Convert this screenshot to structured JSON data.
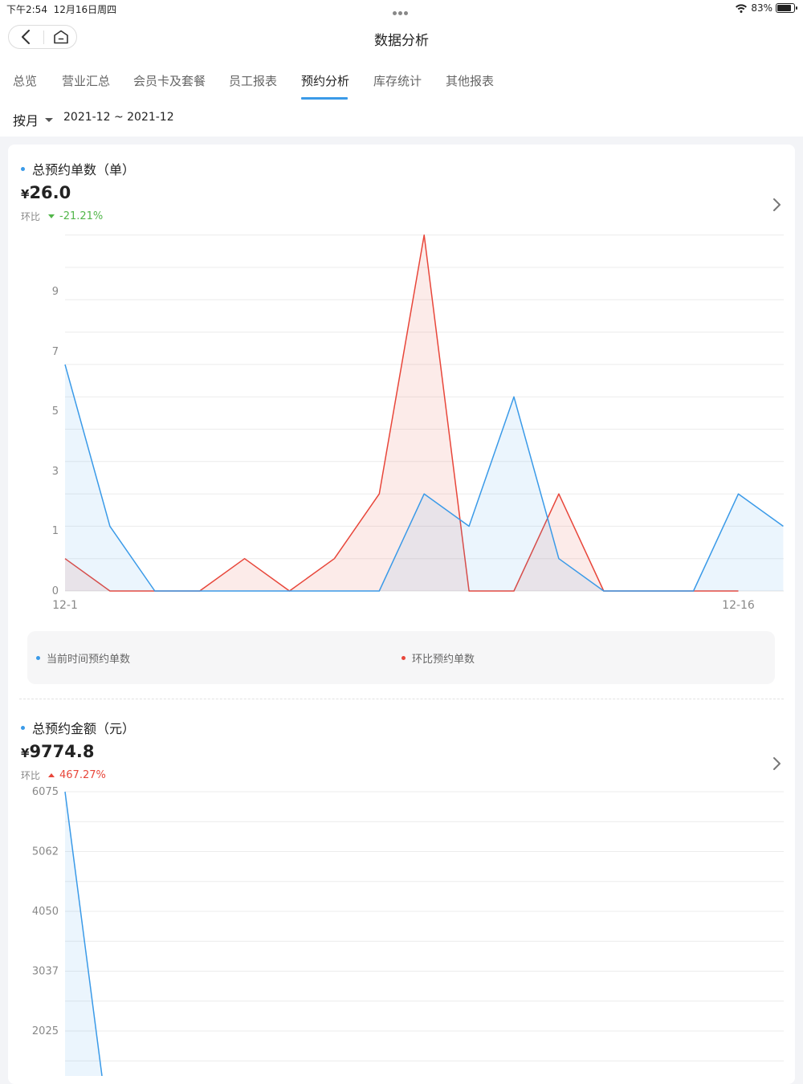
{
  "status": {
    "time": "下午2:54",
    "date": "12月16日周四",
    "battery_pct": "83%",
    "battery_level": 0.83
  },
  "nav": {
    "title": "数据分析"
  },
  "tabs": [
    {
      "label": "总览"
    },
    {
      "label": "营业汇总"
    },
    {
      "label": "会员卡及套餐"
    },
    {
      "label": "员工报表"
    },
    {
      "label": "预约分析"
    },
    {
      "label": "库存统计"
    },
    {
      "label": "其他报表"
    }
  ],
  "active_tab_index": 4,
  "filter": {
    "mode": "按月",
    "range": "2021-12 ~ 2021-12"
  },
  "colors": {
    "current": "#3a9ae8",
    "previous": "#e8463a",
    "up": "#e8463a",
    "down": "#52b64a"
  },
  "section1": {
    "title": "总预约单数（单）",
    "currency": "¥",
    "value": "26.0",
    "change_label": "环比",
    "change_dir": "down",
    "change_pct": "-21.21%"
  },
  "section2": {
    "title": "总预约金额（元）",
    "currency": "¥",
    "value": "9774.8",
    "change_label": "环比",
    "change_dir": "up",
    "change_pct": "467.27%"
  },
  "legend": {
    "current_label": "当前时间预约单数",
    "previous_label": "环比预约单数"
  },
  "chart_data": [
    {
      "type": "area",
      "x_labels": [
        "12-1",
        "12-16"
      ],
      "y_ticks": [
        0,
        1,
        3,
        5,
        7,
        9
      ],
      "ylim": [
        0,
        11
      ],
      "grid": true,
      "series": [
        {
          "name": "当前时间预约单数",
          "values": [
            7,
            2,
            0,
            0,
            0,
            0,
            0,
            0,
            3,
            2,
            6,
            1,
            0,
            0,
            0,
            3,
            2
          ]
        },
        {
          "name": "环比预约单数",
          "values": [
            1,
            0,
            0,
            0,
            1,
            0,
            1,
            3,
            11,
            0,
            0,
            3,
            0,
            0,
            0,
            0
          ]
        }
      ]
    },
    {
      "type": "area",
      "y_ticks": [
        2025,
        3037,
        4050,
        5062,
        6075
      ],
      "ylim": [
        0,
        6075
      ],
      "grid": true,
      "series": [
        {
          "name": "当前时间预约单数",
          "values": [
            6075,
            0
          ]
        }
      ]
    }
  ]
}
